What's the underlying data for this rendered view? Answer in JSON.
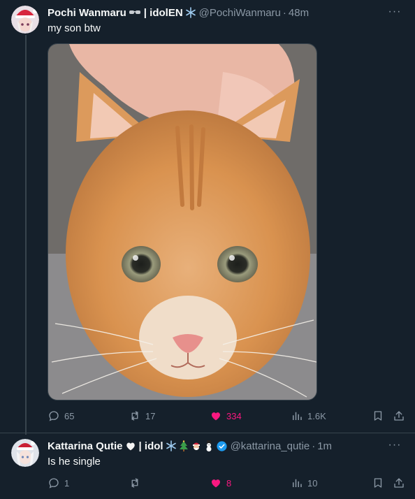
{
  "post1": {
    "author_name": "Pochi Wanmaru",
    "author_suffix": "| idolEN",
    "handle": "@PochiWanmaru",
    "time": "48m",
    "text": "my son btw",
    "more_label": "···",
    "stats": {
      "replies": "65",
      "reposts": "17",
      "likes": "334",
      "views": "1.6K"
    }
  },
  "post2": {
    "author_name": "Kattarina Qutie",
    "author_suffix": "| idol",
    "handle": "@kattarina_qutie",
    "time": "1m",
    "text": "Is he single",
    "more_label": "···",
    "stats": {
      "replies": "1",
      "reposts": "",
      "likes": "8",
      "views": "10"
    }
  },
  "separator": "·",
  "colors": {
    "background": "#15202b",
    "muted": "#8b98a5",
    "like": "#f91880",
    "verified": "#1d9bf0"
  },
  "icons": [
    "reply-icon",
    "repost-icon",
    "like-icon",
    "views-icon",
    "bookmark-icon",
    "share-icon",
    "more-icon",
    "verified-icon",
    "snowflake-icon",
    "heart-emoji",
    "tree-emoji",
    "santa-emoji",
    "snowman-emoji",
    "sunglasses-emoji"
  ]
}
